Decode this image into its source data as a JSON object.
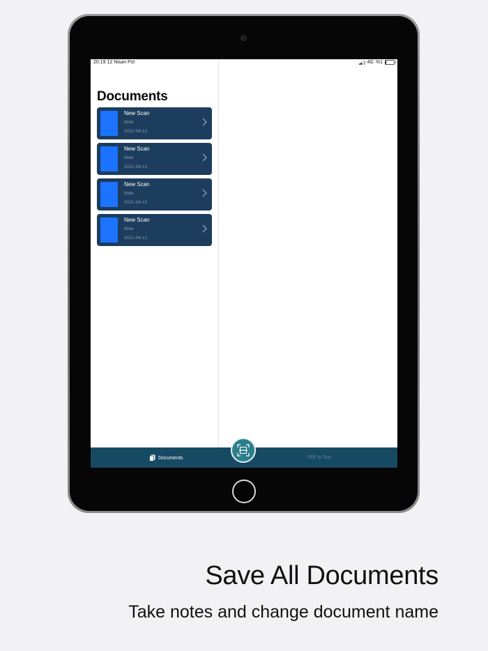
{
  "status_bar": {
    "time_date": "20:19  12 Nisan Pzt",
    "network": "4G",
    "battery": "%1"
  },
  "sidebar": {
    "title": "Documents",
    "documents": [
      {
        "name": "New Scan",
        "note": "Note",
        "date": "2021-04-12"
      },
      {
        "name": "New Scan",
        "note": "Note",
        "date": "2021-04-12"
      },
      {
        "name": "New Scan",
        "note": "Note",
        "date": "2021-04-12"
      },
      {
        "name": "New Scan",
        "note": "Note",
        "date": "2021-04-12"
      }
    ]
  },
  "tab_bar": {
    "documents_label": "Documents",
    "pdf_to_text_label": "PDF to Text",
    "scan_icon": "document-scanner-icon"
  },
  "caption": {
    "title": "Save All Documents",
    "subtitle": "Take notes and change document name"
  },
  "colors": {
    "background": "#f2f2f4",
    "card": "#1c3d5d",
    "thumbnail": "#1b73ff",
    "tab_bar": "#164a63",
    "scan_button": "#2c7e8c"
  }
}
